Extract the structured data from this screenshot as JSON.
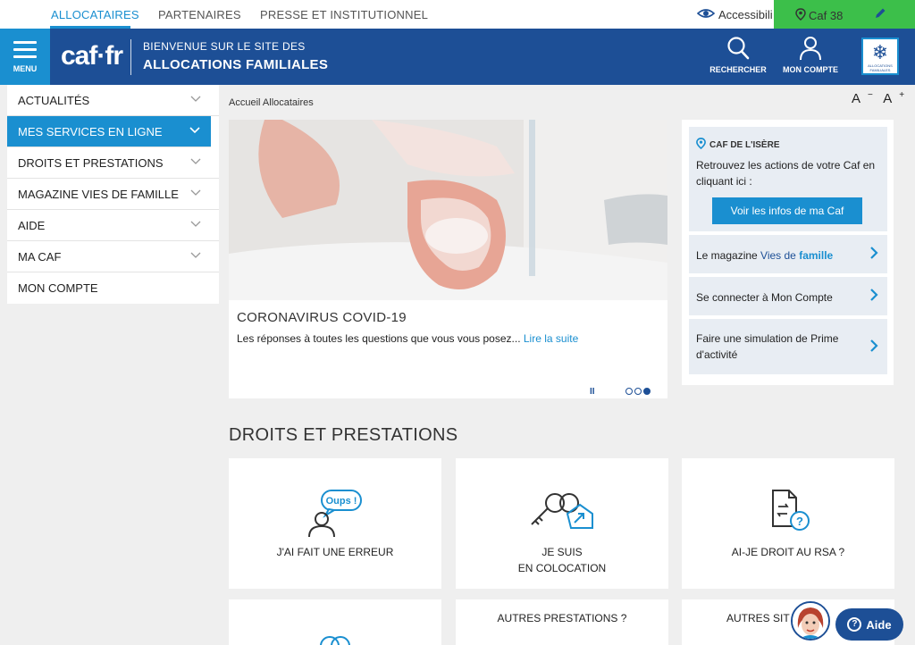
{
  "topnav": {
    "tabs": [
      "ALLOCATAIRES",
      "PARTENAIRES",
      "PRESSE ET INSTITUTIONNEL"
    ],
    "accessibility": "Accessibili",
    "caf_location": "Caf 38"
  },
  "header": {
    "menu_label": "MENU",
    "logo": "caf·fr",
    "welcome_line1": "BIENVENUE SUR LE SITE DES",
    "welcome_line2": "ALLOCATIONS FAMILIALES",
    "search_label": "RECHERCHER",
    "account_label": "MON COMPTE",
    "emblem_text": "ALLOCATIONS FAMILIALES"
  },
  "sidebar": {
    "items": [
      {
        "label": "ACTUALITÉS",
        "has_chevron": true
      },
      {
        "label": "MES SERVICES EN LIGNE",
        "has_chevron": true
      },
      {
        "label": "DROITS ET PRESTATIONS",
        "has_chevron": true
      },
      {
        "label": "MAGAZINE VIES DE FAMILLE",
        "has_chevron": true
      },
      {
        "label": "AIDE",
        "has_chevron": true
      },
      {
        "label": "MA CAF",
        "has_chevron": true
      },
      {
        "label": "MON COMPTE",
        "has_chevron": false
      }
    ]
  },
  "breadcrumb": "Accueil Allocataires",
  "font_controls": {
    "decrease": "A",
    "decrease_sup": "−",
    "increase": "A",
    "increase_sup": "+"
  },
  "slide": {
    "title": "CORONAVIRUS COVID-19",
    "text": "Les réponses à toutes les questions que vous vous posez...",
    "more": "Lire la suite",
    "pause": "II",
    "active_dot": 3,
    "dots": 3
  },
  "right_panel": {
    "caf_name": "CAF DE L'ISÈRE",
    "caf_desc": "Retrouvez les actions de votre Caf en cliquant ici :",
    "caf_button": "Voir les infos de ma Caf",
    "links": [
      {
        "prefix": "Le magazine ",
        "vies": "Vies de ",
        "famille": "famille"
      },
      {
        "label": "Se connecter à Mon Compte"
      },
      {
        "label": "Faire une simulation de Prime d'activité"
      }
    ]
  },
  "droits": {
    "title": "DROITS ET PRESTATIONS",
    "oups": "Oups !",
    "cards": [
      {
        "line1": "J'AI FAIT UNE ERREUR",
        "line2": ""
      },
      {
        "line1": "JE SUIS",
        "line2": "EN COLOCATION"
      },
      {
        "line1": "AI-JE DROIT AU RSA ?",
        "line2": ""
      }
    ],
    "bottom_cards": [
      "",
      "AUTRES PRESTATIONS ?",
      "AUTRES SIT"
    ]
  },
  "aide": {
    "label": "Aide",
    "icon": "?"
  },
  "colors": {
    "primary": "#1d4f96",
    "accent": "#1a8fd0",
    "highlight": "#3cbf4a"
  }
}
